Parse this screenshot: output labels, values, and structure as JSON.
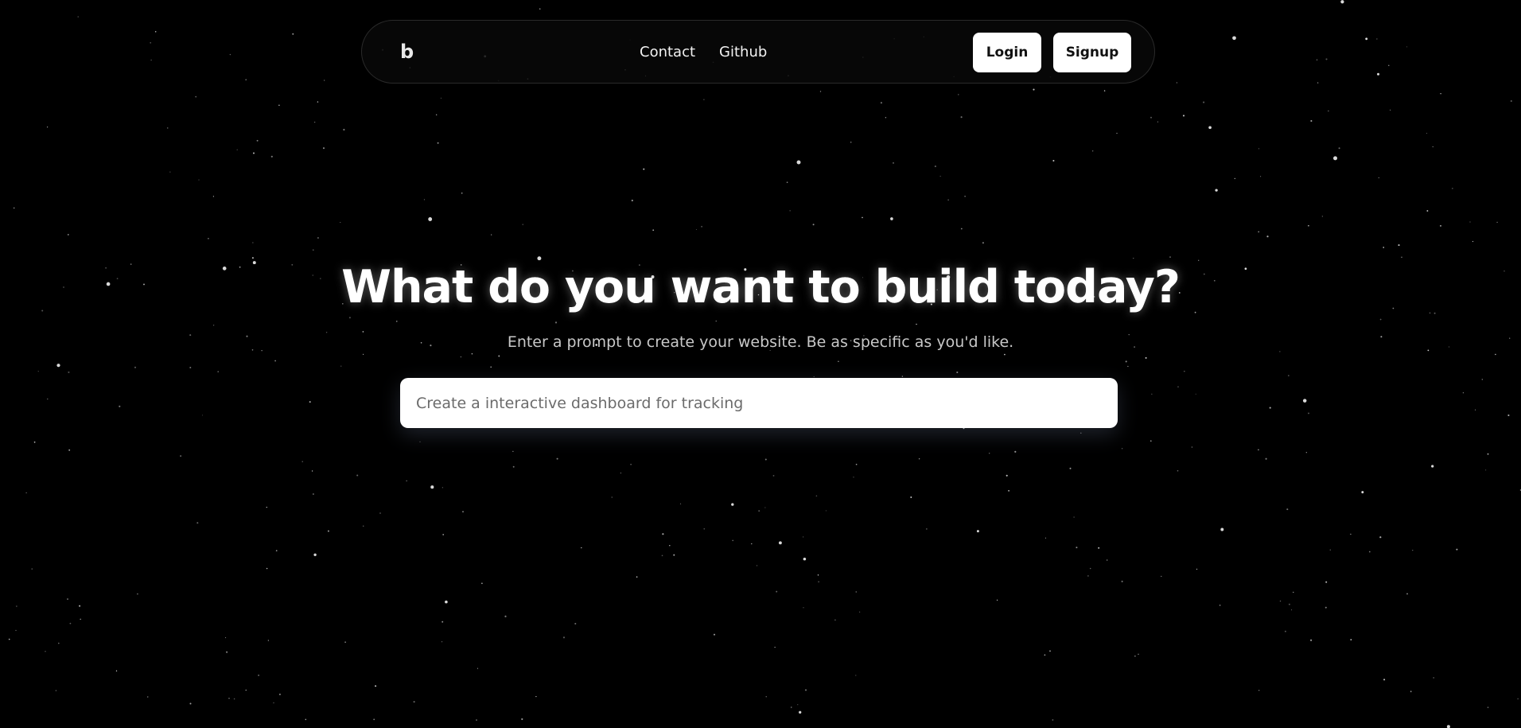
{
  "nav": {
    "logo": "b",
    "links": [
      "Contact",
      "Github"
    ],
    "login_label": "Login",
    "signup_label": "Signup"
  },
  "hero": {
    "title": "What do you want to build today?",
    "subtitle": "Enter a prompt to create your website. Be as specific as you'd like."
  },
  "prompt": {
    "value": "",
    "placeholder": "Create a interactive dashboard for tracking"
  },
  "colors": {
    "background": "#000000",
    "button_bg": "#ffffff",
    "star": "#ffffff"
  }
}
